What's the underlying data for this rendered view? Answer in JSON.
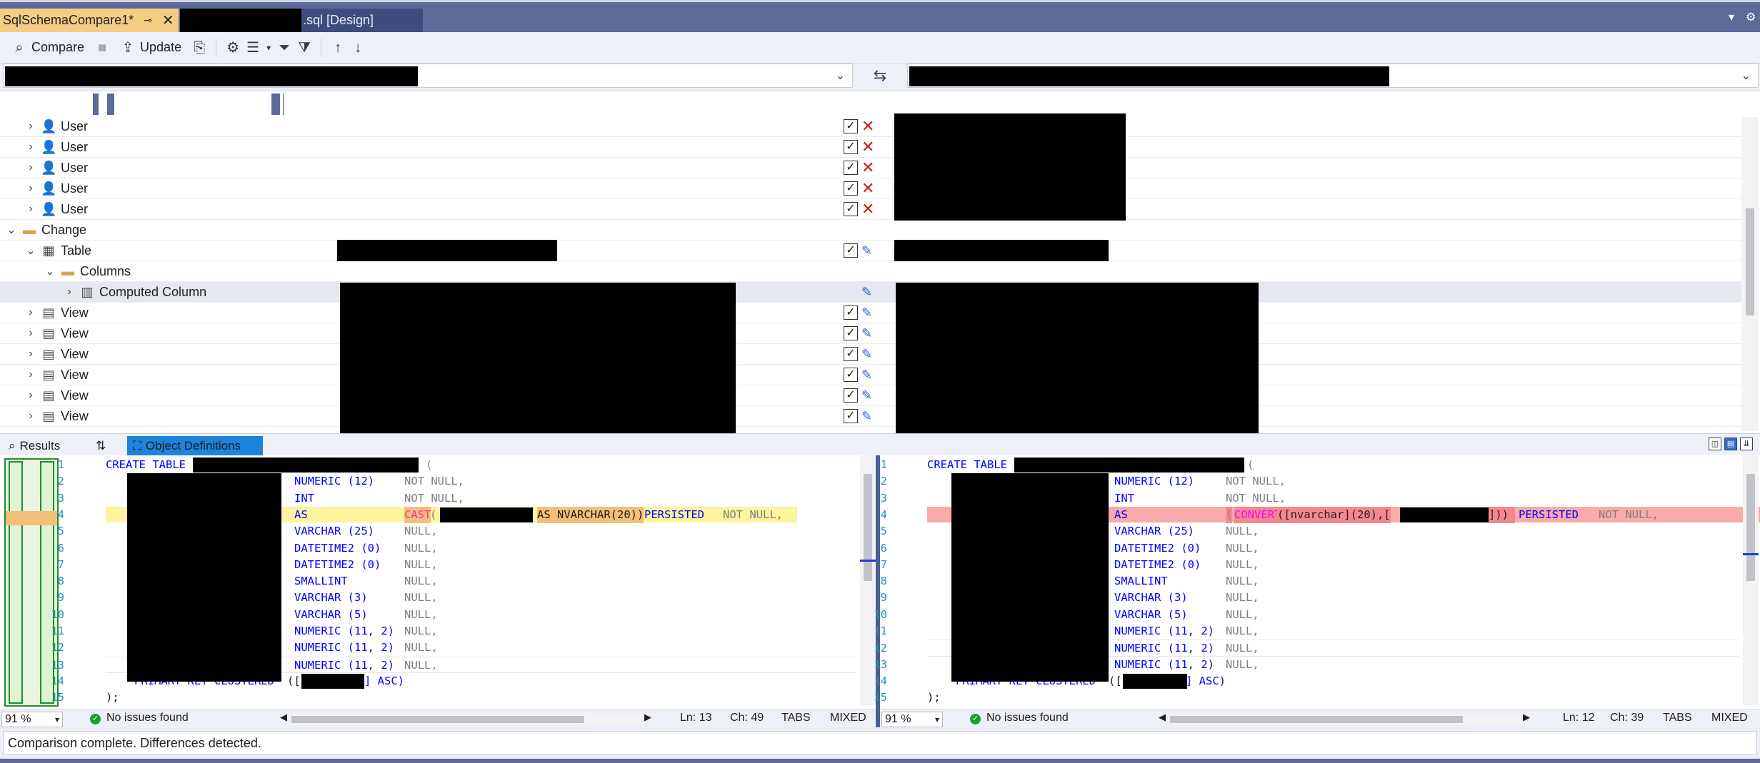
{
  "tabs": [
    {
      "label": "SqlSchemaCompare1*",
      "active": true
    },
    {
      "label": ".sql [Design]",
      "active": false
    }
  ],
  "toolbar": {
    "compare_label": "Compare",
    "update_label": "Update"
  },
  "grid": {
    "rows": [
      {
        "level": 1,
        "expander": "›",
        "icon": "user-icon",
        "label": "User",
        "checked": true,
        "action": "delete"
      },
      {
        "level": 1,
        "expander": "›",
        "icon": "user-icon",
        "label": "User",
        "checked": true,
        "action": "delete"
      },
      {
        "level": 1,
        "expander": "›",
        "icon": "user-icon",
        "label": "User",
        "checked": true,
        "action": "delete"
      },
      {
        "level": 1,
        "expander": "›",
        "icon": "user-icon",
        "label": "User",
        "checked": true,
        "action": "delete"
      },
      {
        "level": 1,
        "expander": "›",
        "icon": "user-icon",
        "label": "User",
        "checked": true,
        "action": "delete"
      },
      {
        "level": 0,
        "expander": "⌄",
        "icon": "folder-icon",
        "label": "Change",
        "checked": null,
        "action": ""
      },
      {
        "level": 1,
        "expander": "⌄",
        "icon": "table-icon",
        "label": "Table",
        "checked": true,
        "action": "edit"
      },
      {
        "level": 2,
        "expander": "⌄",
        "icon": "folder-icon",
        "label": "Columns",
        "checked": null,
        "action": ""
      },
      {
        "level": 3,
        "expander": "›",
        "icon": "computed-column-icon",
        "label": "Computed Column",
        "checked": null,
        "action": "edit",
        "selected": true
      },
      {
        "level": 1,
        "expander": "›",
        "icon": "view-icon",
        "label": "View",
        "checked": true,
        "action": "edit"
      },
      {
        "level": 1,
        "expander": "›",
        "icon": "view-icon",
        "label": "View",
        "checked": true,
        "action": "edit"
      },
      {
        "level": 1,
        "expander": "›",
        "icon": "view-icon",
        "label": "View",
        "checked": true,
        "action": "edit"
      },
      {
        "level": 1,
        "expander": "›",
        "icon": "view-icon",
        "label": "View",
        "checked": true,
        "action": "edit"
      },
      {
        "level": 1,
        "expander": "›",
        "icon": "view-icon",
        "label": "View",
        "checked": true,
        "action": "edit"
      },
      {
        "level": 1,
        "expander": "›",
        "icon": "view-icon",
        "label": "View",
        "checked": true,
        "action": "edit"
      }
    ]
  },
  "bottom_tabs": {
    "results_label": "Results",
    "objdef_label": "Object Definitions"
  },
  "left_pane": {
    "zoom": "91 %",
    "issues": "No issues found",
    "ln": "Ln: 13",
    "ch": "Ch: 49",
    "tabs": "TABS",
    "eol": "MIXED"
  },
  "right_pane": {
    "zoom": "91 %",
    "issues": "No issues found",
    "ln": "Ln: 12",
    "ch": "Ch: 39",
    "tabs": "TABS",
    "eol": "MIXED"
  },
  "code_common": {
    "create_table": "CREATE TABLE",
    "open_paren": "(",
    "l2_type": "NUMERIC (12)",
    "l2_null": "NOT NULL,",
    "l3_type": "INT",
    "l3_null": "NOT NULL,",
    "l4_as": "AS",
    "l5_type": "VARCHAR (25)",
    "l5_null": "NULL,",
    "l6_type": "DATETIME2 (0)",
    "l6_null": "NULL,",
    "l7_type": "DATETIME2 (0)",
    "l7_null": "NULL,",
    "l8_type": "SMALLINT",
    "l8_null": "NULL,",
    "l9_type": "VARCHAR (3)",
    "l9_null": "NULL,",
    "l10_type": "VARCHAR (5)",
    "l10_null": "NULL,",
    "l11_type": "NUMERIC (11, 2)",
    "l11_null": "NULL,",
    "l12_type": "NUMERIC (11, 2)",
    "l12_null": "NULL,",
    "l13_type": "NUMERIC (11, 2)",
    "l13_null": "NULL,",
    "pk": "PRIMARY KEY CLUSTERED",
    "pk_open": "([",
    "pk_close": "] ASC)",
    "end": ");"
  },
  "left_l4": {
    "cast": "CAST",
    "paren": "(",
    "as_type": "AS NVARCHAR(20))",
    "persisted": "PERSISTED",
    "notnull": "NOT NULL,"
  },
  "right_l4": {
    "paren": "(",
    "convert": "CONVERT",
    "args": "([nvarchar](20),[",
    "close": "])) ",
    "persisted": "PERSISTED",
    "notnull": "NOT NULL,"
  },
  "footer": {
    "message": "Comparison complete.  Differences detected."
  }
}
